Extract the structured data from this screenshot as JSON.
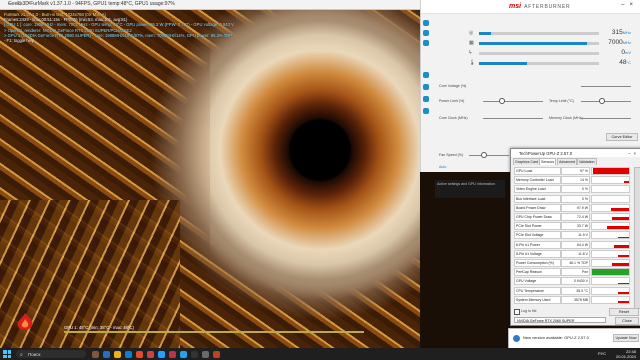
{
  "render_window": {
    "title": "Geeks3D FurMark v1.37.1.0 - 94FPS, GPU1 temp:48°C, GPU1 usage:97%",
    "osd_lines": [
      "FurMark v1.37.1.0 - Burn-in test, 1024x768 (0X MSAA)",
      "Frames:2429 - time:00:51:15s - FPS:76 (min:53, max:101, avg:81)",
      "[ GPU 1 ]: core: 1908 MHz - mem: 7002 MHz - GPU temp: 48°C - GPU power: 95.3 W (PPW: 0.797) - GPU voltage: 0.943 V",
      "> OpenGL renderer: NVIDIA GeForce RTX 2060 SUPER/PCIe/SSE2",
      "> GPU 1 (NVIDIA GeForce RTX 2060 SUPER) - core: 1908MHz/48°C/97%, mem: 7000MHz/14%, GPU power: 95.3% TDP",
      "- F1: toggle help"
    ],
    "osd_bottom": "GPU 1: 48°C (min: 38°C - max: 48°C)"
  },
  "afterburner": {
    "brand": "msi",
    "product": "AFTERBURNER",
    "monitors": [
      {
        "icon": "gpu-clock-icon",
        "value": "315",
        "unit": "MHz",
        "fill": 0.1
      },
      {
        "icon": "mem-clock-icon",
        "value": "7000",
        "unit": "MHz",
        "fill": 0.9
      },
      {
        "icon": "voltage-icon",
        "value": "0",
        "unit": "mV",
        "fill": 0.0
      },
      {
        "icon": "temp-icon",
        "value": "48",
        "unit": "°C",
        "fill": 0.4
      }
    ],
    "labels": {
      "core_voltage": "Core Voltage (%)",
      "power_limit": "Power Limit (%)",
      "temp_limit": "Temp Limit (°C)",
      "core_clock": "Core Clock (MHz)",
      "memory_clock": "Memory Clock (MHz)",
      "fan_speed": "Fan Speed (%)",
      "auto": "Auto",
      "curve_editor": "Curve Editor"
    },
    "slider_values": {
      "power_limit": 100,
      "temp_limit": 88,
      "fan_speed": 37
    },
    "desc_text": "Active settings and GPU information",
    "side_icons": [
      "settings-icon",
      "osd-icon",
      "oc-scanner-icon",
      "info-icon",
      "monitor-icon"
    ]
  },
  "gpuz": {
    "title": "TechPowerUp GPU-Z 2.57.0",
    "tabs": [
      "Graphics Card",
      "Sensors",
      "Advanced",
      "Validation"
    ],
    "active_tab": 1,
    "sensors": [
      {
        "name": "GPU Load",
        "value": "97 %",
        "color": "#e00000",
        "level": 0.97
      },
      {
        "name": "Memory Controller Load",
        "value": "14 %",
        "color": "#e00000",
        "level": 0.14
      },
      {
        "name": "Video Engine Load",
        "value": "0 %",
        "color": "#e00000",
        "level": 0.0
      },
      {
        "name": "Bus Interface Load",
        "value": "0 %",
        "color": "#e00000",
        "level": 0.0
      },
      {
        "name": "Board Power Draw",
        "value": "97.9 W",
        "color": "#e00000",
        "level": 0.5
      },
      {
        "name": "GPU Chip Power Draw",
        "value": "72.4 W",
        "color": "#e00000",
        "level": 0.45
      },
      {
        "name": "PCIe Slot Power",
        "value": "33.7 W",
        "color": "#e00000",
        "level": 0.6
      },
      {
        "name": "PCIe Slot Voltage",
        "value": "11.9 V",
        "color": "#e00000",
        "level": 0.3
      },
      {
        "name": "8-Pin #1 Power",
        "value": "64.4 W",
        "color": "#e00000",
        "level": 0.4
      },
      {
        "name": "8-Pin #1 Voltage",
        "value": "11.8 V",
        "color": "#e00000",
        "level": 0.3
      },
      {
        "name": "Power Consumption (%)",
        "value": "46.1 % TDP",
        "color": "#e00000",
        "level": 0.46
      },
      {
        "name": "PerfCap Reason",
        "value": "Pwr",
        "color": "#2aa02a",
        "level": 1.0
      },
      {
        "name": "GPU Voltage",
        "value": "0.9430 V",
        "color": "#e00000",
        "level": 0.3
      },
      {
        "name": "CPU Temperature",
        "value": "35.0 °C",
        "color": "#e00000",
        "level": 0.3
      },
      {
        "name": "System Memory Used",
        "value": "3578 MB",
        "color": "#e00000",
        "level": 0.3
      }
    ],
    "log_to_file": "Log to file",
    "reset": "Reset",
    "gpu_name": "NVIDIA GeForce RTX 2060 SUPER",
    "close": "Close"
  },
  "notification": {
    "text": "New version available: GPU-Z 2.57.0",
    "button": "Update Now"
  },
  "taskbar": {
    "search_placeholder": "Поиск",
    "time": "22:48",
    "date": "20.01.2024",
    "lang": "РУС",
    "app_icon_colors": [
      "#7a5a3a",
      "#2b6cc4",
      "#f0b020",
      "#0a7fd6",
      "#e34a2b",
      "#d04040",
      "#26a0ff",
      "#c0304a",
      "#2aa0e8",
      "#333333",
      "#6a6a6a",
      "#c04020"
    ]
  }
}
